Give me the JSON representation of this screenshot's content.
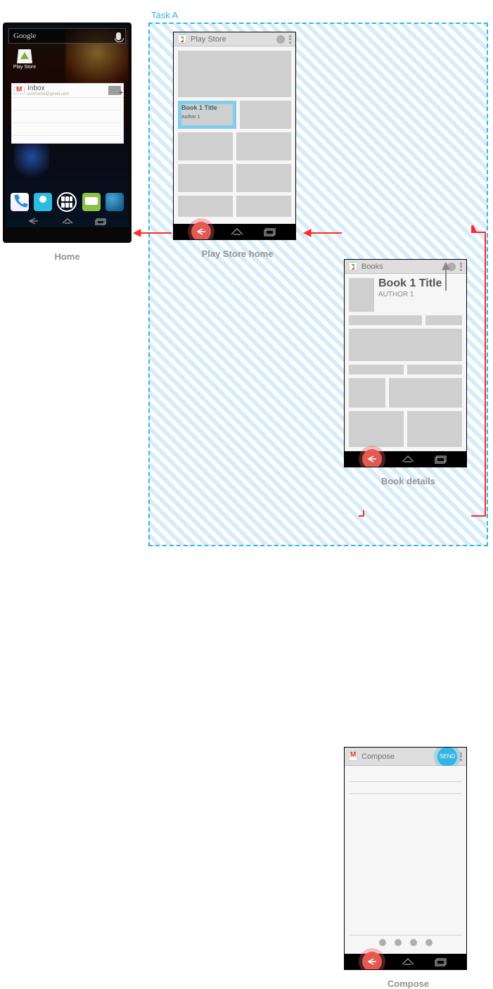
{
  "task_label": "Task A",
  "home": {
    "caption": "Home",
    "search_label": "Google",
    "app_label": "Play Store",
    "widget_title": "Inbox",
    "widget_sub": "username@gmail.com"
  },
  "playstore": {
    "caption": "Play Store home",
    "top_title": "Play Store",
    "book_title": "Book 1 Title",
    "book_author": "Author 1"
  },
  "bookdetails": {
    "caption": "Book details",
    "top_title": "Books",
    "title": "Book 1 Title",
    "author": "AUTHOR 1"
  },
  "compose": {
    "caption": "Compose",
    "top_title": "Compose",
    "send_label": "SEND"
  }
}
